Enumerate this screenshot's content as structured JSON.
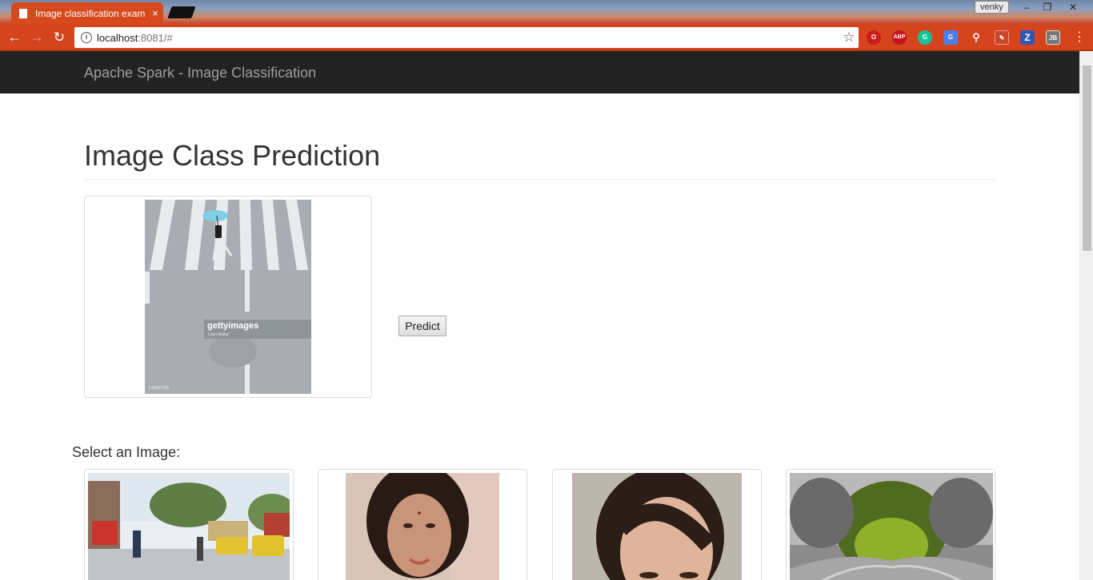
{
  "browser": {
    "tab_title": "Image classification exam",
    "tab_close_glyph": "×",
    "user_name": "venky",
    "url_host": "localhost",
    "url_rest": ":8081/#",
    "extensions": [
      "opera-icon",
      "adblock-plus-icon",
      "grammarly-icon",
      "google-translate-icon",
      "search-extension-icon",
      "pdf-icon",
      "zotero-icon",
      "jb-icon"
    ],
    "extension_labels": {
      "adblock": "ABP",
      "zotero": "Z",
      "jb": "JB"
    },
    "colors": {
      "chrome": "#d4451d",
      "tab": "#d64a1e"
    }
  },
  "navbar": {
    "brand": "Apache Spark - Image Classification"
  },
  "main": {
    "page_title": "Image Class Prediction",
    "predict_button": "Predict",
    "select_label": "Select an Image:",
    "preview_image": {
      "description_icon": "crosswalk-photo",
      "watermark": "gettyimages",
      "watermark_credit": "Lauri Rotko",
      "image_code": "142067756"
    },
    "thumbnails": [
      {
        "name": "street-scene-photo"
      },
      {
        "name": "woman-portrait-photo-1"
      },
      {
        "name": "woman-portrait-photo-2"
      },
      {
        "name": "forest-road-photo"
      }
    ]
  }
}
